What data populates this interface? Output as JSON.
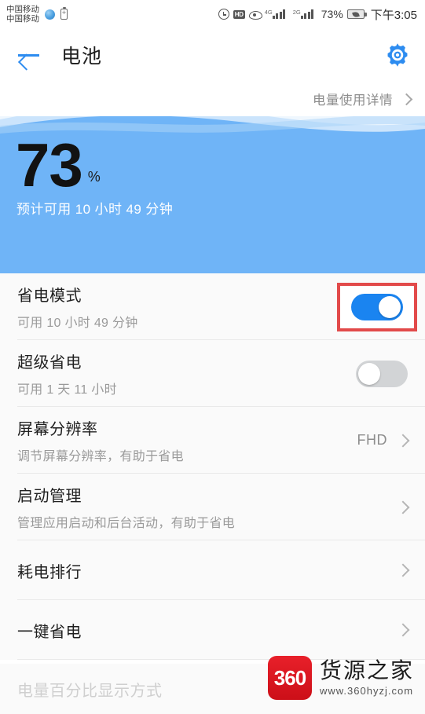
{
  "statusbar": {
    "carrier_line1": "中国移动",
    "carrier_line2": "中国移动",
    "icons": [
      "globe-icon",
      "charging-battery-icon",
      "alarm-icon",
      "hd-icon",
      "eye-icon",
      "signal-4g-icon",
      "signal-2g-icon"
    ],
    "signal_4g_label": "4G",
    "signal_2g_label": "2G",
    "battery_percent": "73%",
    "battery_icon": "battery-saver-leaf-icon",
    "clock": "下午3:05"
  },
  "appbar": {
    "back_icon": "back-arrow-icon",
    "title": "电池",
    "settings_icon": "gear-icon"
  },
  "detail_link": {
    "label": "电量使用详情",
    "chevron": "chevron-right-icon"
  },
  "battery_panel": {
    "level": "73",
    "percent_sign": "%",
    "estimate": "预计可用 10 小时 49 分钟",
    "bg_color": "#6fb4f7",
    "wave_color_light": "#eaf4fd",
    "wave_color_mid": "#9ccdf9"
  },
  "settings": {
    "rows": [
      {
        "title": "省电模式",
        "subtitle": "可用 10 小时 49 分钟",
        "control": "toggle",
        "toggle_state": "on",
        "highlighted": true,
        "accent": "#1a84f0"
      },
      {
        "title": "超级省电",
        "subtitle": "可用 1 天 11 小时",
        "control": "toggle",
        "toggle_state": "off",
        "highlighted": false
      },
      {
        "title": "屏幕分辨率",
        "subtitle": "调节屏幕分辨率，有助于省电",
        "control": "value-chevron",
        "value": "FHD"
      },
      {
        "title": "启动管理",
        "subtitle": "管理应用启动和后台活动，有助于省电",
        "control": "chevron"
      },
      {
        "title": "耗电排行",
        "subtitle": "",
        "control": "chevron"
      },
      {
        "title": "一键省电",
        "subtitle": "",
        "control": "chevron"
      }
    ],
    "footer_row_title": "电量百分比显示方式"
  },
  "watermark": {
    "logo_text": "360",
    "brand": "货源之家",
    "url": "www.360hyzj.com",
    "logo_color": "#d81420"
  }
}
